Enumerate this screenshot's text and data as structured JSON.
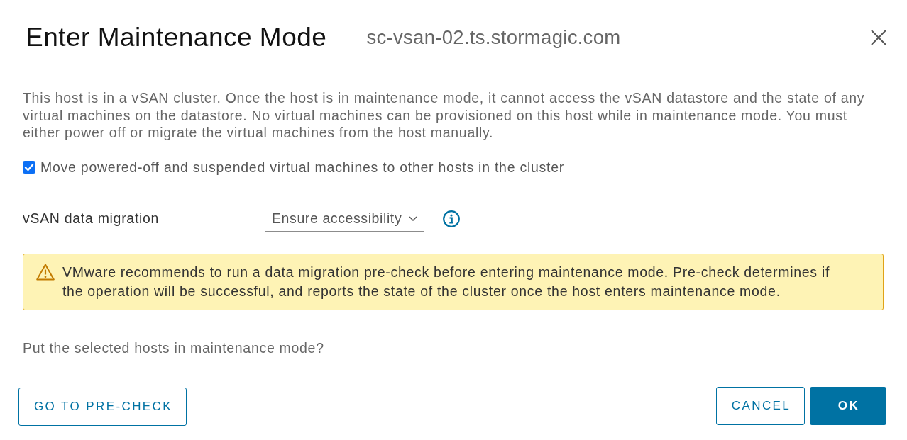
{
  "dialog": {
    "title": "Enter Maintenance Mode",
    "subtitle": "sc-vsan-02.ts.stormagic.com"
  },
  "message": "This host is in a vSAN cluster. Once the host is in maintenance mode, it cannot access the vSAN datastore and the state of any virtual machines on the datastore. No virtual machines can be provisioned on this host while in maintenance mode. You must either power off or migrate the virtual machines from the host manually.",
  "move_vms": {
    "label": "Move powered-off and suspended virtual machines to other hosts in the cluster",
    "checked": true
  },
  "data_migration": {
    "label": "vSAN data migration",
    "value": "Ensure accessibility"
  },
  "alert": {
    "kind": "warning",
    "text": "VMware recommends to run a data migration pre-check before entering maintenance mode. Pre-check determines if the operation will be successful, and reports the state of the cluster once the host enters maintenance mode."
  },
  "question": "Put the selected hosts in maintenance mode?",
  "footer": {
    "start": [
      {
        "label": "GO TO PRE-CHECK",
        "kind": "outline"
      }
    ],
    "end": [
      {
        "label": "CANCEL",
        "kind": "outline"
      },
      {
        "label": "OK",
        "kind": "primary"
      }
    ]
  }
}
